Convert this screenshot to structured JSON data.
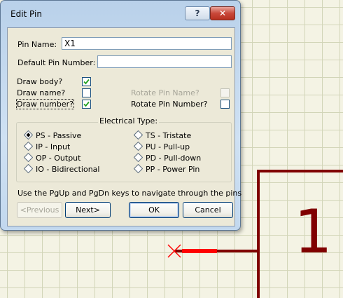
{
  "dialog": {
    "title": "Edit Pin",
    "help_glyph": "?",
    "close_glyph": "✕"
  },
  "fields": {
    "pin_name": {
      "label": "Pin Name:",
      "value": "X1"
    },
    "default_pin_number": {
      "label": "Default Pin Number:",
      "value": ""
    }
  },
  "options": {
    "draw_body": {
      "label": "Draw body?",
      "checked": true
    },
    "draw_name": {
      "label": "Draw name?",
      "checked": false
    },
    "draw_number": {
      "label": "Draw number?",
      "checked": true
    },
    "rotate_pin_name": {
      "label": "Rotate Pin Name?",
      "checked": false,
      "enabled": false
    },
    "rotate_pin_number": {
      "label": "Rotate Pin Number?",
      "checked": false,
      "enabled": true
    }
  },
  "electrical_type": {
    "title": "Electrical Type:",
    "selected": "PS - Passive",
    "options": [
      "PS - Passive",
      "IP - Input",
      "OP - Output",
      "IO - Bidirectional",
      "TS - Tristate",
      "PU - Pull-up",
      "PD - Pull-down",
      "PP - Power Pin"
    ]
  },
  "hint": "Use the PgUp and PgDn keys to navigate through the pins",
  "buttons": {
    "previous": "<Previous",
    "next": "Next>",
    "ok": "OK",
    "cancel": "Cancel"
  },
  "schematic": {
    "pin_number": "1",
    "body_color": "#800000",
    "pin_color": "#ff0000"
  }
}
